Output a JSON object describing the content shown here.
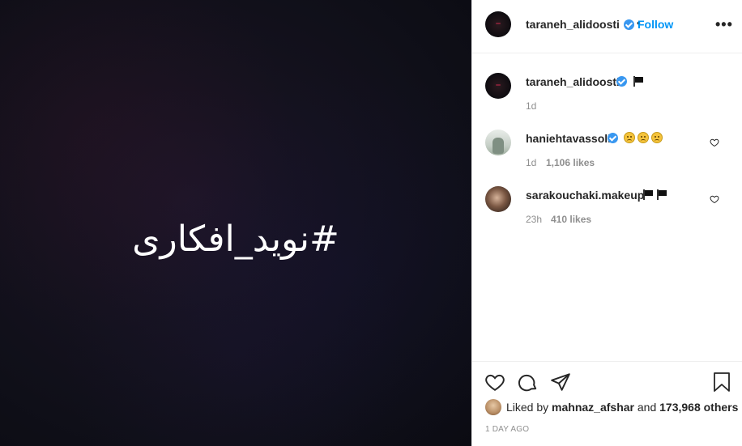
{
  "media": {
    "text": "#نوید_افکاری"
  },
  "header": {
    "username": "taraneh_alidoosti",
    "separator": "•",
    "follow_label": "Follow",
    "more_label": "•••"
  },
  "caption": {
    "username": "taraneh_alidoosti",
    "emojis": [
      "black-flag"
    ],
    "age": "1d"
  },
  "comments": [
    {
      "username": "haniehtavassoli",
      "verified": true,
      "emojis": [
        "disappointed-face",
        "disappointed-face",
        "disappointed-face"
      ],
      "age": "1d",
      "likes": "1,106 likes"
    },
    {
      "username": "sarakouchaki.makeup",
      "verified": false,
      "emojis": [
        "black-flag",
        "black-flag"
      ],
      "age": "23h",
      "likes": "410 likes"
    }
  ],
  "footer": {
    "liked_by_prefix": "Liked by",
    "liked_by_user": "mahnaz_afshar",
    "and_label": "and",
    "others_label": "173,968 others",
    "timestamp": "1 DAY AGO"
  },
  "colors": {
    "accent": "#0095f6",
    "verified": "#3897f0",
    "muted": "#8e8e8e",
    "text": "#262626"
  }
}
